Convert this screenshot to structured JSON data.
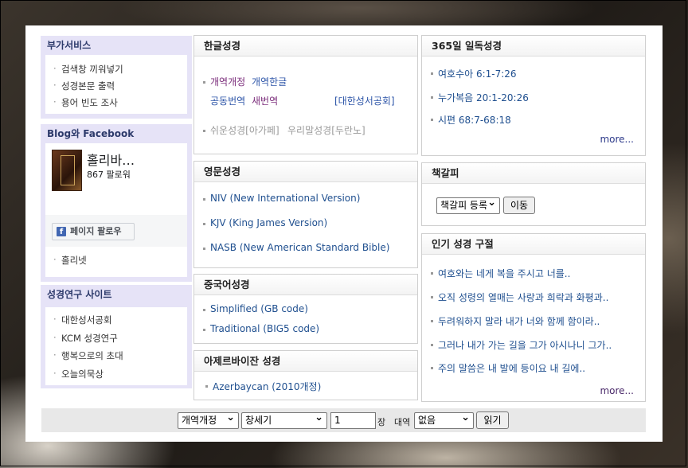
{
  "left": {
    "services": {
      "title": "부가서비스",
      "items": [
        "검색창 끼워넣기",
        "성경본문 출력",
        "용어 빈도 조사"
      ]
    },
    "social": {
      "title": "Blog와 Facebook",
      "page_name": "홀리바…",
      "followers": "867 팔로워",
      "follow_button": "페이지 팔로우",
      "fb_icon": "f",
      "link": "홀리넷"
    },
    "research": {
      "title": "성경연구 사이트",
      "items": [
        "대한성서공회",
        "KCM 성경연구",
        "행복으로의 초대",
        "오늘의묵상"
      ]
    }
  },
  "korean": {
    "title": "한글성경",
    "row1": [
      "개역개정",
      "개역한글"
    ],
    "row2": [
      "공동번역",
      "새번역",
      "[대한성서공회]"
    ],
    "row3": [
      "쉬운성경[아가페]",
      "우리말성경[두란노]"
    ]
  },
  "english": {
    "title": "영문성경",
    "items": [
      "NIV (New International Version)",
      "KJV (King James Version)",
      "NASB (New American Standard Bible)"
    ]
  },
  "chinese": {
    "title": "중국어성경",
    "items": [
      "Simplified (GB code)",
      "Traditional (BIG5 code)"
    ]
  },
  "azerbaijani": {
    "title": "아제르바이잔 성경",
    "items": [
      "Azerbaycan (2010개정)"
    ]
  },
  "daily": {
    "title": "365일 일독성경",
    "items": [
      "여호수아 6:1-7:26",
      "누가복음 20:1-20:26",
      "시편 68:7-68:18"
    ],
    "more": "more..."
  },
  "bookmark": {
    "title": "책갈피",
    "select_value": "책갈피 등록",
    "go_button": "이동"
  },
  "popular": {
    "title": "인기 성경 구절",
    "items": [
      "여호와는 네게 복을 주시고 너를..",
      "오직 성령의 열매는 사랑과 희락과 화평과..",
      "두려워하지 말라 내가 너와 함께 함이라..",
      "그러나 내가 가는 길을 그가 아시나니 그가..",
      "주의 말씀은 내 발에 등이요 내 길에.."
    ],
    "more": "more..."
  },
  "reader": {
    "version": "개역개정",
    "book": "창세기",
    "chapter": "1",
    "chapter_label": "장",
    "compare_label": "대역",
    "compare_value": "없음",
    "read_button": "읽기"
  },
  "colors": {
    "link": "#1f4f8f",
    "header_accent": "#2d3a6b",
    "left_panel": "#e6e3f7"
  }
}
